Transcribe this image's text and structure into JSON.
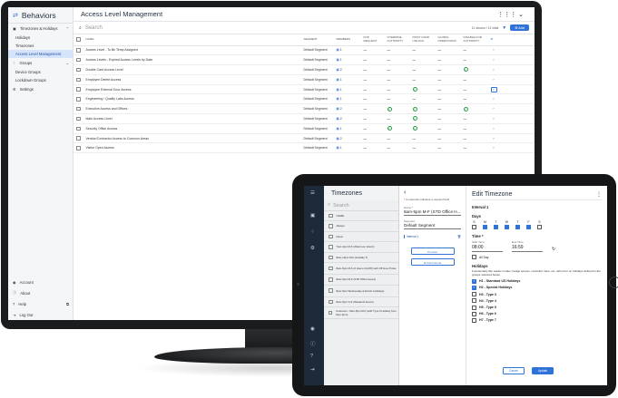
{
  "desktop": {
    "app_title": "Behaviors",
    "page_title": "Access Level Management",
    "sidebar": {
      "groups": [
        {
          "label": "Timezones & Holidays",
          "items": [
            "Holidays",
            "Timezones",
            "Access Level Management"
          ]
        },
        {
          "label": "Groups",
          "items": [
            "Device Groups",
            "Lockdown Groups"
          ]
        },
        {
          "label": "Settings",
          "items": []
        }
      ],
      "bottom": [
        "Account",
        "About",
        "Help",
        "Log Out"
      ]
    },
    "toolbar": {
      "search_placeholder": "Search",
      "shown_text": "11 shown / 11 total",
      "add_label": "Add"
    },
    "columns": [
      "NAME",
      "SEGMENT",
      "MEMBERS",
      "FOP REQUEST",
      "OVERRIDE AUTHORITY",
      "FIRST CARD UNLOCK",
      "GLOBAL OPERATIONS",
      "DISABLE FOR AUTHORITY"
    ],
    "rows": [
      {
        "name": "Access Level - To Be Temp Assigned",
        "segment": "Default Segment",
        "members": "1",
        "marks": [
          "—",
          "—",
          "—",
          "—",
          "—"
        ],
        "highlight": false
      },
      {
        "name": "Access Levels - Expired Access Levels by Date",
        "segment": "Default Segment",
        "members": "1",
        "marks": [
          "—",
          "—",
          "—",
          "—",
          "—"
        ],
        "highlight": false
      },
      {
        "name": "Double Card Access Level",
        "segment": "Default Segment",
        "members": "2",
        "marks": [
          "—",
          "—",
          "—",
          "—",
          "ok"
        ],
        "highlight": false
      },
      {
        "name": "Employee Delete Access",
        "segment": "Default Segment",
        "members": "1",
        "marks": [
          "—",
          "—",
          "—",
          "—",
          "—"
        ],
        "highlight": false
      },
      {
        "name": "Employee External Door Access",
        "segment": "Default Segment",
        "members": "1",
        "marks": [
          "—",
          "—",
          "ok",
          "—",
          "—"
        ],
        "highlight": true
      },
      {
        "name": "Engineering / Quality Labs Access",
        "segment": "Default Segment",
        "members": "1",
        "marks": [
          "—",
          "—",
          "—",
          "—",
          "—"
        ],
        "highlight": false
      },
      {
        "name": "Executive Access and Offices",
        "segment": "Default Segment",
        "members": "2",
        "marks": [
          "—",
          "ok",
          "ok",
          "—",
          "ok"
        ],
        "highlight": false
      },
      {
        "name": "Main Access Level",
        "segment": "Default Segment",
        "members": "2",
        "marks": [
          "—",
          "—",
          "ok",
          "—",
          "—"
        ],
        "highlight": false
      },
      {
        "name": "Security Office Access",
        "segment": "Default Segment",
        "members": "1",
        "marks": [
          "—",
          "ok",
          "ok",
          "—",
          "—"
        ],
        "highlight": false
      },
      {
        "name": "Vendor/Contractor Access to Common Areas",
        "segment": "Default Segment",
        "members": "2",
        "marks": [
          "—",
          "—",
          "—",
          "—",
          "—"
        ],
        "highlight": false
      },
      {
        "name": "Visitor Open Access",
        "segment": "Default Segment",
        "members": "1",
        "marks": [
          "—",
          "—",
          "—",
          "—",
          "—"
        ],
        "highlight": false
      }
    ]
  },
  "tablet": {
    "list_title": "Timezones",
    "search_placeholder": "Search",
    "list_header": "NAME",
    "items": [
      "Always",
      "Never",
      "7am-4pm M-F (Afternoon Hours)",
      "8am-12pm M-F (Holiday T)",
      "8am-5pm M-F (2 Hours On/Off) with Off Hour Pulse",
      "8am-5pm M-F (STD Office Hours)",
      "8am-5pm Wednesday (Hold AL Holidays)",
      "8am-5pm S-S (Weekend Hours)",
      "Customer - 8am-5pm M-F (with Type 6 Holiday from 9pm-3pm)"
    ],
    "mid": {
      "required_note": "An asterisk indicates a required field",
      "name_label": "Name *",
      "name_value": "8am-5pm M-F (STD Office H...",
      "segment_label": "Segment",
      "segment_value": "Default Segment",
      "interval_label": "Interval 1",
      "preview_label": "Preview",
      "add_interval_label": "Add Interval"
    },
    "edit": {
      "title": "Edit Timezone",
      "interval_heading": "Interval 1",
      "days_heading": "Days",
      "days": [
        {
          "letter": "S",
          "on": false
        },
        {
          "letter": "M",
          "on": true
        },
        {
          "letter": "T",
          "on": true
        },
        {
          "letter": "W",
          "on": true
        },
        {
          "letter": "T",
          "on": true
        },
        {
          "letter": "F",
          "on": true
        },
        {
          "letter": "S",
          "on": false
        }
      ],
      "time_heading": "Time *",
      "start_label": "Start Time",
      "start_value": "08:00",
      "end_label": "End Time",
      "end_value": "16:59",
      "all_day_label": "All Day",
      "holidays_heading": "Holidays",
      "holidays_desc": "Functionality like reader modes, badge access, controller rules, etc. will occur on holidays defined in the groups selected below.",
      "holidays": [
        {
          "label": "H1 - Standard US Holidays",
          "on": true
        },
        {
          "label": "H2 - Special Holidays",
          "on": true
        },
        {
          "label": "H3 - Type 3",
          "on": false
        },
        {
          "label": "H4 - Type 4",
          "on": false
        },
        {
          "label": "H5 - Type 5",
          "on": false
        },
        {
          "label": "H6 - Type 6",
          "on": false
        },
        {
          "label": "H7 - Type 7",
          "on": false
        }
      ],
      "cancel_label": "Cancel",
      "update_label": "Update"
    }
  },
  "colors": {
    "accent": "#2f73d8",
    "success": "#2e9b4a",
    "rail": "#1d2a3a",
    "bezel": "#1b1c1e"
  }
}
